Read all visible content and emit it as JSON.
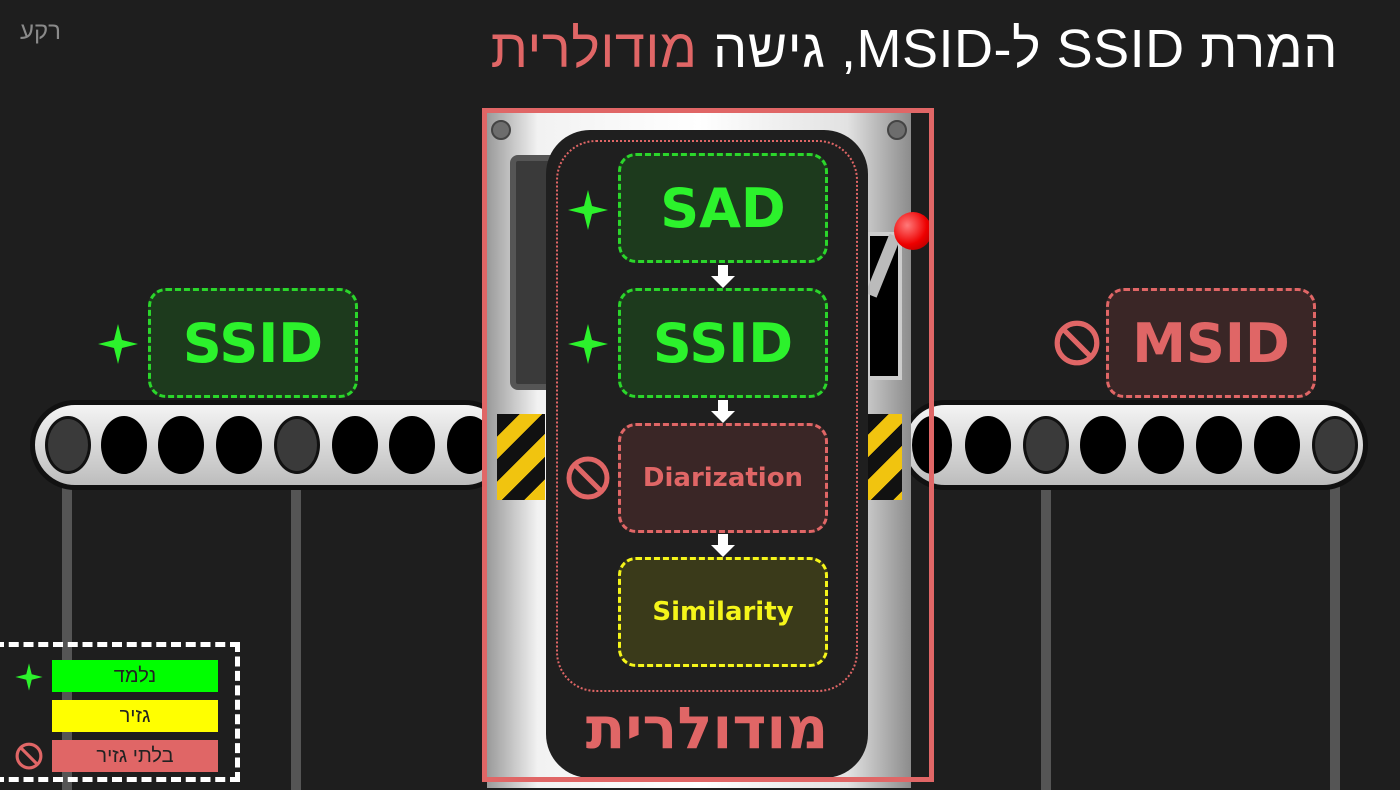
{
  "header": {
    "title_main": "המרת SSID ל-MSID, גישה",
    "title_highlight": "מודולרית",
    "corner_label": "רקע"
  },
  "input_box": {
    "label": "SSID",
    "status": "learned"
  },
  "output_box": {
    "label": "MSID",
    "status": "not-differentiable"
  },
  "pipeline": {
    "title": "מודולרית",
    "steps": [
      {
        "label": "SAD",
        "status": "learned"
      },
      {
        "label": "SSID",
        "status": "learned"
      },
      {
        "label": "Diarization",
        "status": "not-differentiable"
      },
      {
        "label": "Similarity",
        "status": "differentiable"
      }
    ]
  },
  "legend": {
    "items": [
      {
        "label": "נלמד",
        "color": "#00ff00",
        "icon": "sparkle-icon"
      },
      {
        "label": "גזיר",
        "color": "#ffff00",
        "icon": ""
      },
      {
        "label": "בלתי גזיר",
        "color": "#e06666",
        "icon": "prohibited-icon"
      }
    ]
  },
  "colors": {
    "accent_red": "#e06666",
    "learned_green": "#2cf22c",
    "differentiable_yellow": "#f5f51a",
    "background": "#1e1e1e"
  }
}
